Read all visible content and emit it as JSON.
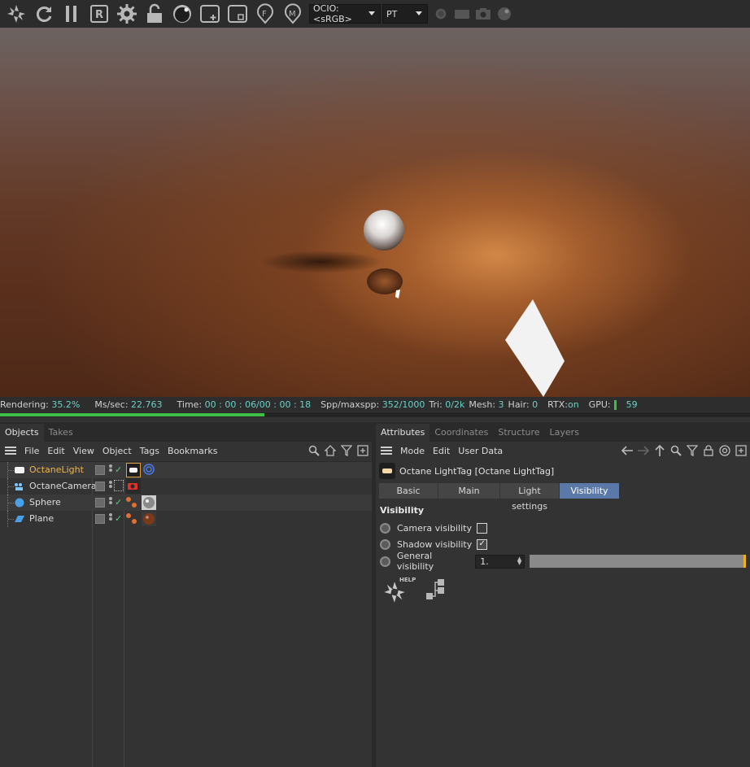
{
  "toolbar": {
    "icons": [
      "octane-logo-icon",
      "refresh-icon",
      "pause-icon",
      "region-render-icon",
      "settings-gear-icon",
      "lock-icon",
      "sphere-icon",
      "add-region-icon",
      "focus-icon",
      "film-icon",
      "material-pin-icon"
    ],
    "color_space": "OCIO:<sRGB>",
    "render_mode": "PT"
  },
  "status": {
    "rendering_label": "Rendering:",
    "rendering_value": "35.2%",
    "mssec_label": "Ms/sec:",
    "mssec_value": "22.763",
    "time_label": "Time:",
    "time_value": "00 : 00 : 06/00 : 00 : 18",
    "spp_label": "Spp/maxspp:",
    "spp_value": "352/1000",
    "tri_label": "Tri:",
    "tri_value": "0/2k",
    "mesh_label": "Mesh:",
    "mesh_value": "3",
    "hair_label": "Hair:",
    "hair_value": "0",
    "rtx_label": "RTX:",
    "rtx_value": "on",
    "gpu_label": "GPU:",
    "gpu_value": "59",
    "progress": 0.352
  },
  "objects_panel": {
    "tabs": [
      "Objects",
      "Takes"
    ],
    "menu": [
      "File",
      "Edit",
      "View",
      "Object",
      "Tags",
      "Bookmarks"
    ],
    "items": [
      {
        "name": "OctaneLight",
        "selected": true
      },
      {
        "name": "OctaneCamera",
        "selected": false
      },
      {
        "name": "Sphere",
        "selected": false
      },
      {
        "name": "Plane",
        "selected": false
      }
    ]
  },
  "attributes_panel": {
    "tabs": [
      "Attributes",
      "Coordinates",
      "Structure",
      "Layers"
    ],
    "menu": [
      "Mode",
      "Edit",
      "User Data"
    ],
    "object_title": "Octane LightTag [Octane LightTag]",
    "sub_tabs": [
      "Basic",
      "Main",
      "Light settings",
      "Visibility"
    ],
    "active_sub_tab": "Visibility",
    "section_title": "Visibility",
    "params": {
      "camera_visibility_label": "Camera visibility",
      "camera_visibility": false,
      "shadow_visibility_label": "Shadow visibility",
      "shadow_visibility": true,
      "general_visibility_label": "General visibility",
      "general_visibility_value": "1.",
      "general_visibility_slider": 1.0
    },
    "help_label": "HELP"
  }
}
